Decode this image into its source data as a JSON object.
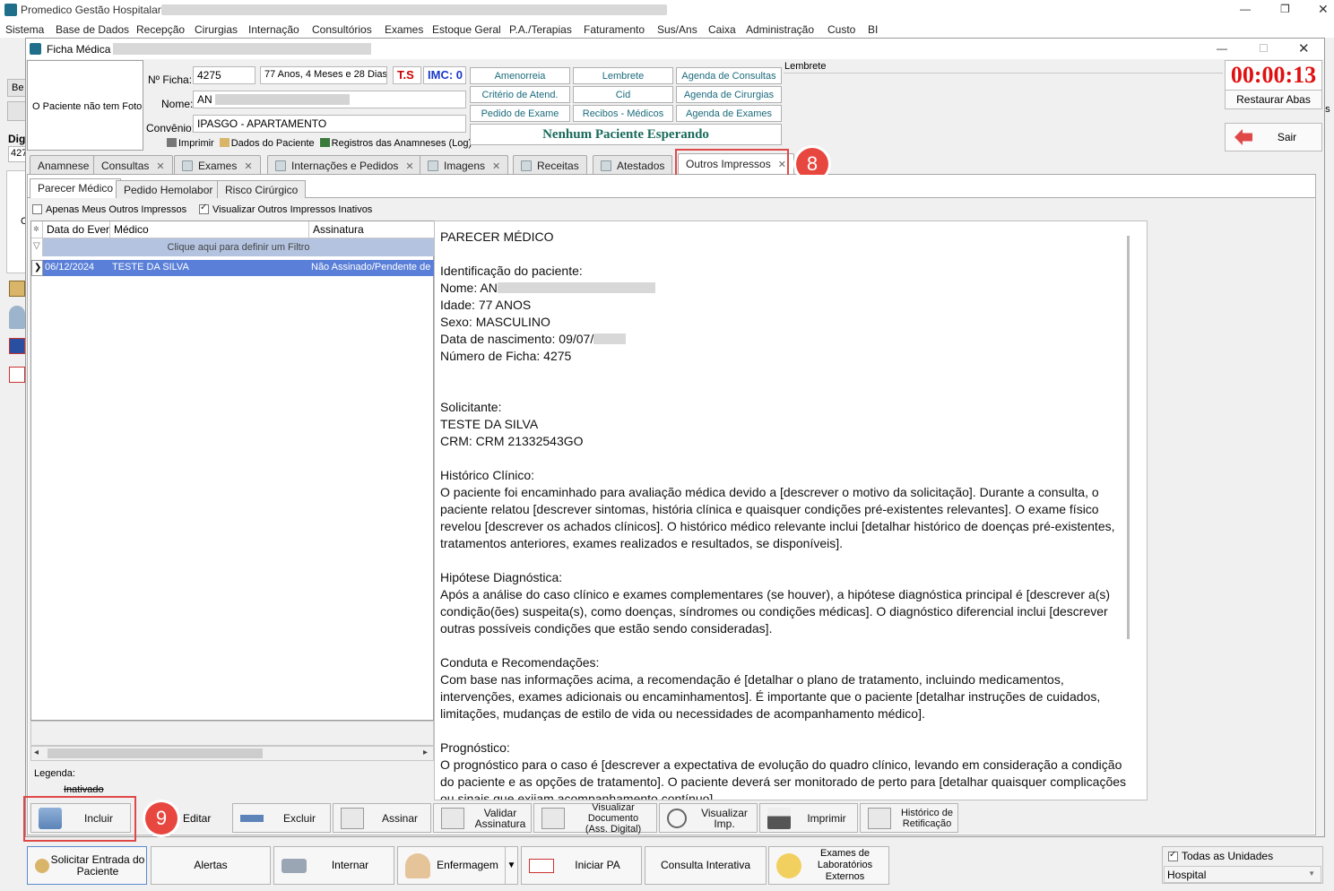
{
  "app": {
    "title": "Promedico Gestão Hospitalar",
    "menu": [
      "Sistema",
      "Base de Dados",
      "Recepção",
      "Cirurgias",
      "Internação",
      "Consultórios",
      "Exames",
      "Estoque Geral",
      "P.A./Terapias",
      "Faturamento",
      "Sus/Ans",
      "Caixa",
      "Administração",
      "Custo",
      "BI"
    ],
    "side_labels": {
      "be": "Be",
      "dig": "Dig",
      "num": "427",
      "c": "C",
      "as": "as"
    }
  },
  "window": {
    "title": "Ficha Médica",
    "photo_text": "O Paciente não tem Foto",
    "labels": {
      "ficha": "Nº Ficha:",
      "nome": "Nome:",
      "convenio": "Convênio:",
      "lembrete": "Lembrete"
    },
    "ficha": "4275",
    "idade": "77 Anos, 4 Meses e 28 Dias",
    "ts": "T.S",
    "imc": "IMC: 0",
    "nome": "AN",
    "convenio": "IPASGO - APARTAMENTO",
    "actions": [
      "Imprimir",
      "Dados do Paciente",
      "Registros das Anamneses (Log)"
    ],
    "links": [
      "Amenorreia",
      "Lembrete",
      "Agenda de Consultas",
      "Critério de Atend.",
      "Cid",
      "Agenda de Cirurgias",
      "Pedido de Exame",
      "Recibos - Médicos",
      "Agenda de Exames"
    ],
    "waiting": "Nenhum Paciente Esperando",
    "timer": "00:00:13",
    "restore_tabs": "Restaurar Abas",
    "exit": "Sair"
  },
  "tabs": [
    "Anamnese",
    "Consultas",
    "Exames",
    "Internações e Pedidos",
    "Imagens",
    "Receitas",
    "Atestados",
    "Outros Impressos"
  ],
  "subtabs": [
    "Parecer Médico",
    "Pedido Hemolabor",
    "Risco Cirúrgico"
  ],
  "filters": {
    "mine_only": "Apenas Meus Outros Impressos",
    "show_inactive": "Visualizar Outros Impressos Inativos"
  },
  "grid": {
    "columns": [
      "Data do Even",
      "Médico",
      "Assinatura"
    ],
    "filter_hint": "Clique aqui para definir um Filtro",
    "rows": [
      {
        "data": "06/12/2024",
        "medico": "TESTE DA SILVA",
        "assinatura": "Não Assinado/Pendente de"
      }
    ]
  },
  "legend": {
    "title": "Legenda:",
    "inactive": "Inativado"
  },
  "document": {
    "title": "PARECER MÉDICO",
    "id_title": "Identificação do paciente:",
    "nome": "Nome: AN",
    "idade": "Idade: 77 ANOS",
    "sexo": "Sexo: MASCULINO",
    "nascimento": "Data de nascimento: 09/07/",
    "ficha": "Número de Ficha: 4275",
    "sol_title": "Solicitante:",
    "sol_nome": "TESTE DA SILVA",
    "sol_crm": "CRM: CRM 21332543GO",
    "hist_title": "Histórico Clínico:",
    "hist_text": "O paciente foi encaminhado para avaliação médica devido a [descrever o motivo da solicitação]. Durante a consulta, o paciente relatou [descrever sintomas, história clínica e quaisquer condições pré-existentes relevantes]. O exame físico revelou [descrever os achados clínicos]. O histórico médico relevante inclui [detalhar histórico de doenças pré-existentes, tratamentos anteriores, exames realizados e resultados, se disponíveis].",
    "hip_title": "Hipótese Diagnóstica:",
    "hip_text": "Após a análise do caso clínico e exames complementares (se houver), a hipótese diagnóstica principal é [descrever a(s) condição(ões) suspeita(s), como doenças, síndromes ou condições médicas]. O diagnóstico diferencial inclui [descrever outras possíveis condições que estão sendo consideradas].",
    "cond_title": "Conduta e Recomendações:",
    "cond_text": "Com base nas informações acima, a recomendação é [detalhar o plano de tratamento, incluindo medicamentos, intervenções, exames adicionais ou encaminhamentos]. É importante que o paciente [detalhar instruções de cuidados, limitações, mudanças de estilo de vida ou necessidades de acompanhamento médico].",
    "prog_title": "Prognóstico:",
    "prog_text": "O prognóstico para o caso é [descrever a expectativa de evolução do quadro clínico, levando em consideração a condição do paciente e as opções de tratamento]. O paciente deverá ser monitorado de perto para [detalhar quaisquer complicações ou sinais que exijam acompanhamento contínuo]."
  },
  "buttons": {
    "incluir": "Incluir",
    "editar": "Editar",
    "excluir": "Excluir",
    "assinar": "Assinar",
    "validar": "Validar\nAssinatura",
    "visualizar_doc": "Visualizar Documento\n(Ass. Digital)",
    "visualizar_imp": "Visualizar Imp.",
    "imprimir": "Imprimir",
    "historico": "Histórico de\nRetificação"
  },
  "footer": {
    "solicitar": "Solicitar Entrada do\nPaciente",
    "alertas": "Alertas",
    "internar": "Internar",
    "enfermagem": "Enfermagem",
    "iniciar_pa": "Iniciar PA",
    "consulta": "Consulta Interativa",
    "exames_lab": "Exames de\nLaboratórios\nExternos",
    "todas_unidades": "Todas as Unidades",
    "unidade": "Hospital"
  },
  "markers": {
    "m8": "8",
    "m9": "9"
  },
  "colors": {
    "accent_red": "#e8473f",
    "timer": "#e01010",
    "link": "#1a6b7c",
    "row_sel": "#5a7fd8"
  }
}
